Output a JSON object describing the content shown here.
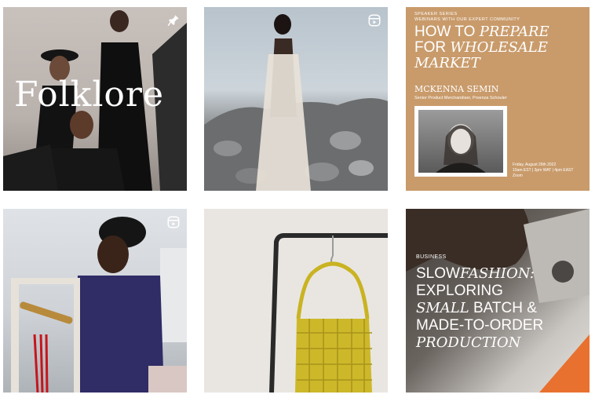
{
  "grid": {
    "posts": [
      {
        "id": "post-1",
        "overlay_text": "Folklore",
        "badge_icon": "pin-icon"
      },
      {
        "id": "post-2",
        "badge_icon": "reel-icon"
      },
      {
        "id": "post-3",
        "series_line1": "SPEAKER SERIES",
        "series_line2": "WEBINARS WITH OUR EXPERT COMMUNITY",
        "title_line1": "HOW TO",
        "title_line1_italic": "PREPARE",
        "title_line2": "FOR",
        "title_line2_italic": "WHOLESALE",
        "title_line3_italic": "MARKET",
        "speaker_name": "MCKENNA SEMIN",
        "speaker_role": "Senior Product Merchandiser, Proenza Schouler",
        "date_line1": "Friday, August 26th 2022",
        "date_line2": "10am EST | 3pm WAT | 4pm EAST",
        "date_line3": "Zoom"
      },
      {
        "id": "post-4",
        "badge_icon": "reel-icon"
      },
      {
        "id": "post-5"
      },
      {
        "id": "post-6",
        "category": "BUSINESS",
        "title_line1": "SLOW",
        "title_line1_italic": "FASHION:",
        "title_line2": "EXPLORING",
        "title_line3_italic": "SMALL",
        "title_line3": "BATCH &",
        "title_line4": "MADE-TO-ORDER",
        "title_line5_italic": "PRODUCTION"
      }
    ]
  },
  "colors": {
    "post3_background": "#c99b6b",
    "post6_accent": "#e8712f"
  }
}
